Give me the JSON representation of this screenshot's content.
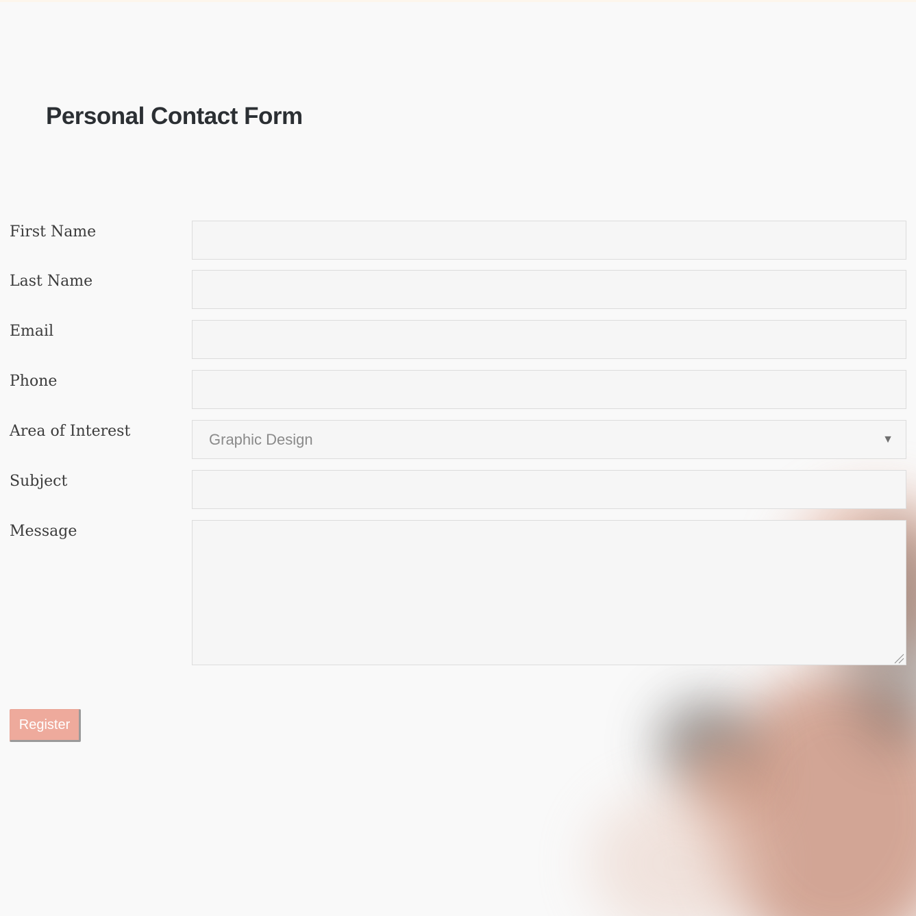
{
  "form": {
    "title": "Personal Contact Form",
    "fields": {
      "first_name": {
        "label": "First Name",
        "value": ""
      },
      "last_name": {
        "label": "Last Name",
        "value": ""
      },
      "email": {
        "label": "Email",
        "value": ""
      },
      "phone": {
        "label": "Phone",
        "value": ""
      },
      "area_of_interest": {
        "label": "Area of Interest",
        "selected": "Graphic Design"
      },
      "subject": {
        "label": "Subject",
        "value": ""
      },
      "message": {
        "label": "Message",
        "value": ""
      }
    },
    "submit_label": "Register"
  },
  "icons": {
    "select_arrow": "chevron-down-icon",
    "resize_handle": "resize-grip-icon"
  },
  "colors": {
    "button_bg": "#eeaa9c",
    "title": "#2b2f33",
    "field_bg": "#f6f6f6"
  }
}
